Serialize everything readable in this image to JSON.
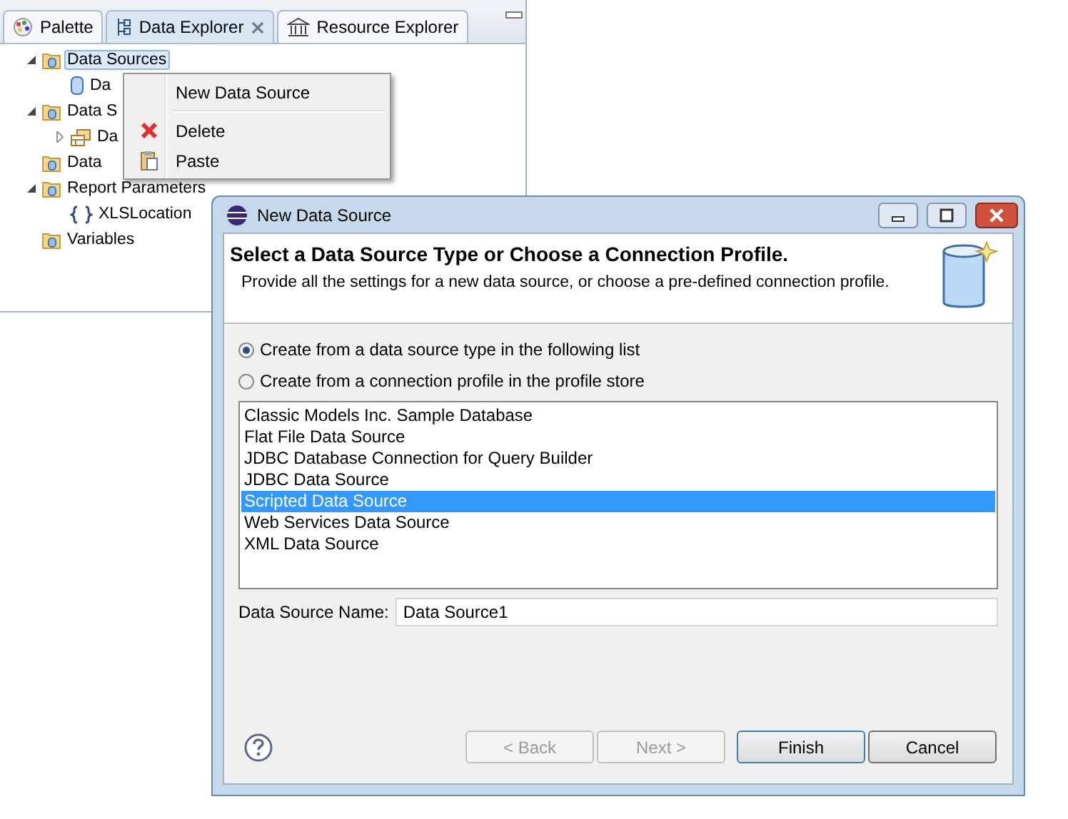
{
  "view": {
    "tabs": [
      {
        "label": "Palette",
        "selected": false
      },
      {
        "label": "Data Explorer",
        "selected": true
      },
      {
        "label": "Resource Explorer",
        "selected": false
      }
    ],
    "tree": [
      {
        "label": "Data Sources",
        "expanded": true,
        "selected": true,
        "children": [
          {
            "label": "Da",
            "selected": false
          }
        ]
      },
      {
        "label": "Data S",
        "expanded": true,
        "selected": false,
        "children": [
          {
            "label": "Da",
            "expanded": false,
            "selected": false
          }
        ]
      },
      {
        "label": "Data",
        "selected": false
      },
      {
        "label": "Report Parameters",
        "expanded": true,
        "selected": false,
        "children": [
          {
            "label": "XLSLocation",
            "selected": false
          }
        ]
      },
      {
        "label": "Variables",
        "selected": false
      }
    ]
  },
  "context_menu": {
    "items": [
      {
        "kind": "item",
        "label": "New Data Source"
      },
      {
        "kind": "separator"
      },
      {
        "kind": "item",
        "label": "Delete"
      },
      {
        "kind": "item",
        "label": "Paste"
      }
    ]
  },
  "dialog": {
    "title": "New Data Source",
    "heading": "Select a Data Source Type or Choose a Connection Profile.",
    "description": "Provide all the settings for a new data source, or choose a pre-defined connection profile.",
    "options": [
      {
        "label": "Create from a data source type in the following list",
        "selected": true
      },
      {
        "label": "Create from a connection profile in the profile store",
        "selected": false
      }
    ],
    "list": [
      {
        "label": "Classic Models Inc. Sample Database",
        "selected": false
      },
      {
        "label": "Flat File Data Source",
        "selected": false
      },
      {
        "label": "JDBC Database Connection for Query Builder",
        "selected": false
      },
      {
        "label": "JDBC Data Source",
        "selected": false
      },
      {
        "label": "Scripted Data Source",
        "selected": true
      },
      {
        "label": "Web Services Data Source",
        "selected": false
      },
      {
        "label": "XML Data Source",
        "selected": false
      }
    ],
    "name_field": {
      "label": "Data Source Name:",
      "value": "Data Source1"
    },
    "buttons": [
      {
        "label": "< Back",
        "disabled": true,
        "default": false
      },
      {
        "label": "Next >",
        "disabled": true,
        "default": false
      },
      {
        "label": "Finish",
        "disabled": false,
        "default": true
      },
      {
        "label": "Cancel",
        "disabled": false,
        "default": false
      }
    ]
  }
}
